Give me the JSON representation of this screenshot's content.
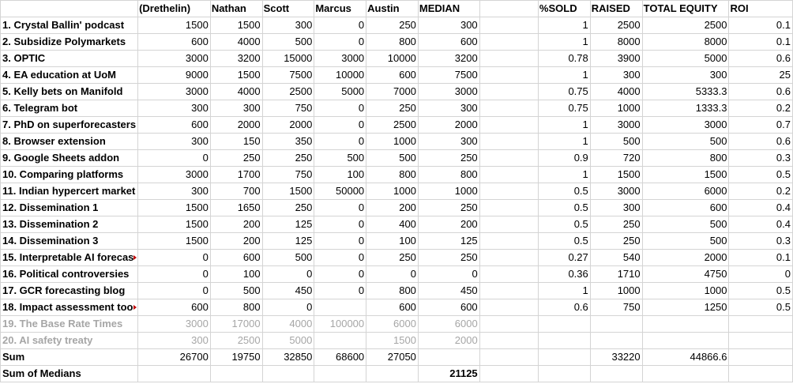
{
  "headers": [
    "",
    "(Drethelin)",
    "Nathan",
    "Scott",
    "Marcus",
    "Austin",
    "MEDIAN",
    "",
    "%SOLD",
    "RAISED",
    "TOTAL EQUITY",
    "ROI"
  ],
  "rows": [
    {
      "name": "1. Crystal Ballin' podcast",
      "cells": [
        "1500",
        "1500",
        "300",
        "0",
        "250",
        "300",
        "",
        "1",
        "2500",
        "2500",
        "0.1"
      ]
    },
    {
      "name": "2. Subsidize Polymarkets",
      "cells": [
        "600",
        "4000",
        "500",
        "0",
        "800",
        "600",
        "",
        "1",
        "8000",
        "8000",
        "0.1"
      ]
    },
    {
      "name": "3. OPTIC",
      "cells": [
        "3000",
        "3200",
        "15000",
        "3000",
        "10000",
        "3200",
        "",
        "0.78",
        "3900",
        "5000",
        "0.6"
      ]
    },
    {
      "name": "4. EA education at UoM",
      "cells": [
        "9000",
        "1500",
        "7500",
        "10000",
        "600",
        "7500",
        "",
        "1",
        "300",
        "300",
        "25"
      ]
    },
    {
      "name": "5. Kelly bets on Manifold",
      "cells": [
        "3000",
        "4000",
        "2500",
        "5000",
        "7000",
        "3000",
        "",
        "0.75",
        "4000",
        "5333.3",
        "0.6"
      ]
    },
    {
      "name": "6. Telegram bot",
      "cells": [
        "300",
        "300",
        "750",
        "0",
        "250",
        "300",
        "",
        "0.75",
        "1000",
        "1333.3",
        "0.2"
      ]
    },
    {
      "name": "7. PhD on superforecasters",
      "cells": [
        "600",
        "2000",
        "2000",
        "0",
        "2500",
        "2000",
        "",
        "1",
        "3000",
        "3000",
        "0.7"
      ]
    },
    {
      "name": "8. Browser extension",
      "cells": [
        "300",
        "150",
        "350",
        "0",
        "1000",
        "300",
        "",
        "1",
        "500",
        "500",
        "0.6"
      ]
    },
    {
      "name": "9. Google Sheets addon",
      "cells": [
        "0",
        "250",
        "250",
        "500",
        "500",
        "250",
        "",
        "0.9",
        "720",
        "800",
        "0.3"
      ]
    },
    {
      "name": "10. Comparing platforms",
      "cells": [
        "3000",
        "1700",
        "750",
        "100",
        "800",
        "800",
        "",
        "1",
        "1500",
        "1500",
        "0.5"
      ]
    },
    {
      "name": "11. Indian hypercert market",
      "cells": [
        "300",
        "700",
        "1500",
        "50000",
        "1000",
        "1000",
        "",
        "0.5",
        "3000",
        "6000",
        "0.2"
      ]
    },
    {
      "name": "12. Dissemination 1",
      "cells": [
        "1500",
        "1650",
        "250",
        "0",
        "200",
        "250",
        "",
        "0.5",
        "300",
        "600",
        "0.4"
      ]
    },
    {
      "name": "13. Dissemination 2",
      "cells": [
        "1500",
        "200",
        "125",
        "0",
        "400",
        "200",
        "",
        "0.5",
        "250",
        "500",
        "0.4"
      ]
    },
    {
      "name": "14. Dissemination 3",
      "cells": [
        "1500",
        "200",
        "125",
        "0",
        "100",
        "125",
        "",
        "0.5",
        "250",
        "500",
        "0.3"
      ]
    },
    {
      "name": "15. Interpretable AI forecas",
      "trunc": true,
      "cells": [
        "0",
        "600",
        "500",
        "0",
        "250",
        "250",
        "",
        "0.27",
        "540",
        "2000",
        "0.1"
      ]
    },
    {
      "name": "16. Political controversies",
      "cells": [
        "0",
        "100",
        "0",
        "0",
        "0",
        "0",
        "",
        "0.36",
        "1710",
        "4750",
        "0"
      ]
    },
    {
      "name": "17. GCR forecasting blog",
      "cells": [
        "0",
        "500",
        "450",
        "0",
        "800",
        "450",
        "",
        "1",
        "1000",
        "1000",
        "0.5"
      ]
    },
    {
      "name": "18. Impact assessment too",
      "trunc": true,
      "cells": [
        "600",
        "800",
        "0",
        "",
        "600",
        "600",
        "",
        "0.6",
        "750",
        "1250",
        "0.5"
      ]
    },
    {
      "name": "19. The Base Rate Times",
      "gray": true,
      "cells": [
        "3000",
        "17000",
        "4000",
        "100000",
        "6000",
        "6000",
        "",
        "",
        "",
        "",
        ""
      ]
    },
    {
      "name": "20. AI safety treaty",
      "gray": true,
      "cells": [
        "300",
        "2500",
        "5000",
        "",
        "1500",
        "2000",
        "",
        "",
        "",
        "",
        ""
      ]
    }
  ],
  "sum": {
    "name": "Sum",
    "cells": [
      "26700",
      "19750",
      "32850",
      "68600",
      "27050",
      "",
      "",
      "",
      "33220",
      "44866.6",
      ""
    ]
  },
  "sum_medians": {
    "name": "Sum of Medians",
    "cells": [
      "",
      "",
      "",
      "",
      "",
      "21125",
      "",
      "",
      "",
      "",
      ""
    ]
  }
}
